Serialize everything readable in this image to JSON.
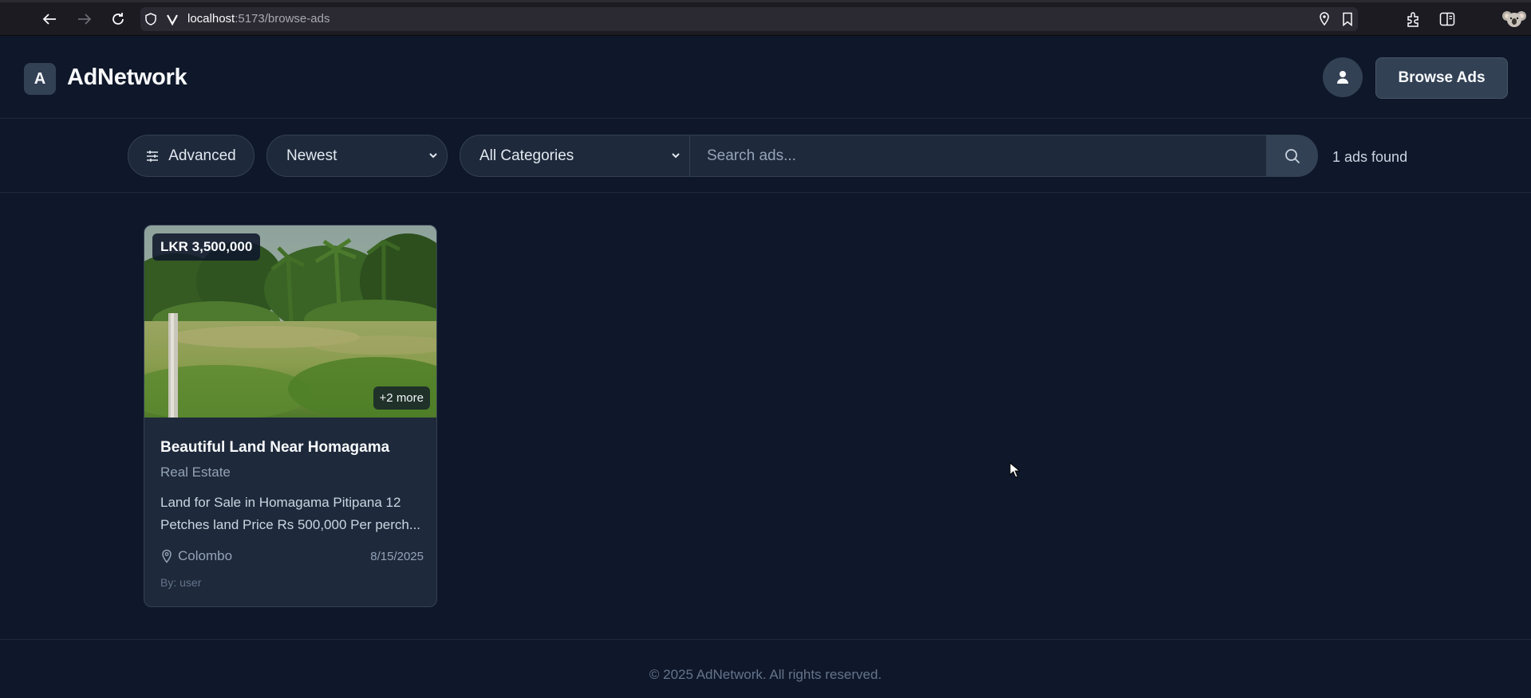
{
  "browser": {
    "url_host": "localhost",
    "url_path": ":5173/browse-ads",
    "icons": [
      "back-arrow-icon",
      "forward-arrow-icon",
      "reload-icon",
      "shield-icon",
      "site-icon",
      "location-pin-icon",
      "bookmark-icon",
      "extensions-icon",
      "sidebar-icon",
      "koala-avatar-icon"
    ]
  },
  "header": {
    "logo_letter": "A",
    "brand": "AdNetwork",
    "browse_label": "Browse Ads"
  },
  "filters": {
    "advanced_label": "Advanced",
    "sort_value": "Newest",
    "category_value": "All Categories",
    "search_placeholder": "Search ads...",
    "results_count": "1 ads found"
  },
  "ads": [
    {
      "price": "LKR 3,500,000",
      "more_images": "+2 more",
      "title": "Beautiful Land Near Homagama",
      "category": "Real Estate",
      "description": "Land for Sale in Homagama Pitipana 12 Petches land Price Rs 500,000 Per perch...",
      "location": "Colombo",
      "date": "8/15/2025",
      "author": "By: user"
    }
  ],
  "footer": {
    "copyright": "© 2025 AdNetwork. All rights reserved."
  },
  "colors": {
    "background": "#0f172a",
    "surface": "#1e293b",
    "border": "#334155"
  }
}
